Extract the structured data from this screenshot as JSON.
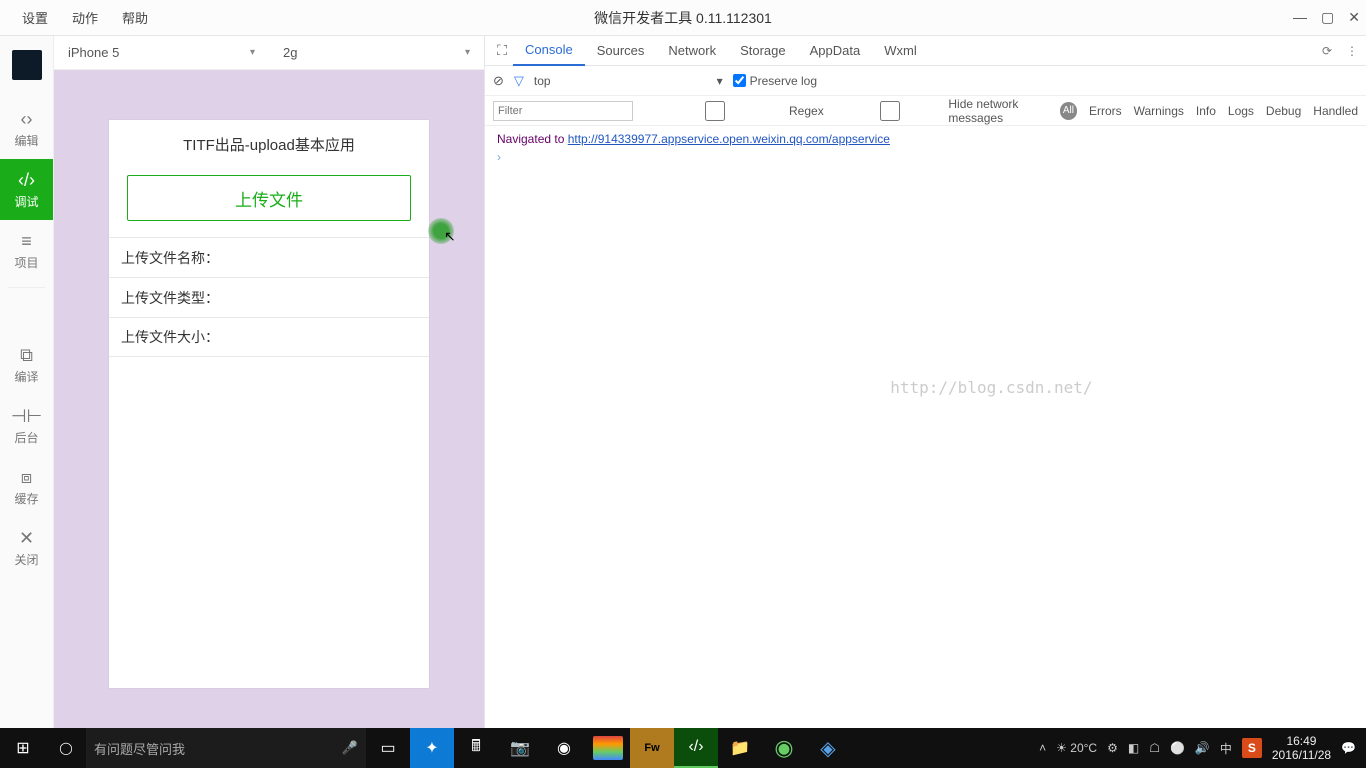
{
  "menubar": {
    "items": [
      "设置",
      "动作",
      "帮助"
    ],
    "title": "微信开发者工具 0.11.112301",
    "win": {
      "min": "—",
      "max": "▢",
      "close": "✕"
    }
  },
  "sidebar": {
    "items": [
      {
        "icon": "‹›",
        "label": "编辑"
      },
      {
        "icon": "‹/›",
        "label": "调试"
      },
      {
        "icon": "≡",
        "label": "项目"
      },
      {
        "icon": "⧉",
        "label": "编译"
      },
      {
        "icon": "⊣⊢",
        "label": "后台"
      },
      {
        "icon": "⧈",
        "label": "缓存"
      },
      {
        "icon": "✕",
        "label": "关闭"
      }
    ]
  },
  "sim": {
    "device": "iPhone 5",
    "network": "2g",
    "caret": "▾",
    "phone": {
      "title": "TITF出品-upload基本应用",
      "button": "上传文件",
      "rows": [
        "上传文件名称：",
        "上传文件类型：",
        "上传文件大小："
      ]
    }
  },
  "devtools": {
    "tabs": [
      "Console",
      "Sources",
      "Network",
      "Storage",
      "AppData",
      "Wxml"
    ],
    "console_toolbar": {
      "top": "top",
      "preserve": "Preserve log",
      "caret": "▾"
    },
    "filterbar": {
      "placeholder": "Filter",
      "regex": "Regex",
      "hide": "Hide network messages",
      "all": "All",
      "levels": [
        "Errors",
        "Warnings",
        "Info",
        "Logs",
        "Debug",
        "Handled"
      ]
    },
    "log": {
      "nav_label": "Navigated to ",
      "nav_url": "http://914339977.appservice.open.weixin.qq.com/appservice",
      "prompt": "›"
    },
    "watermark": "http://blog.csdn.net/"
  },
  "taskbar": {
    "search_placeholder": "有问题尽管问我",
    "weather": "20°C",
    "ime": "中",
    "s": "S",
    "clock": {
      "time": "16:49",
      "date": "2016/11/28"
    }
  }
}
